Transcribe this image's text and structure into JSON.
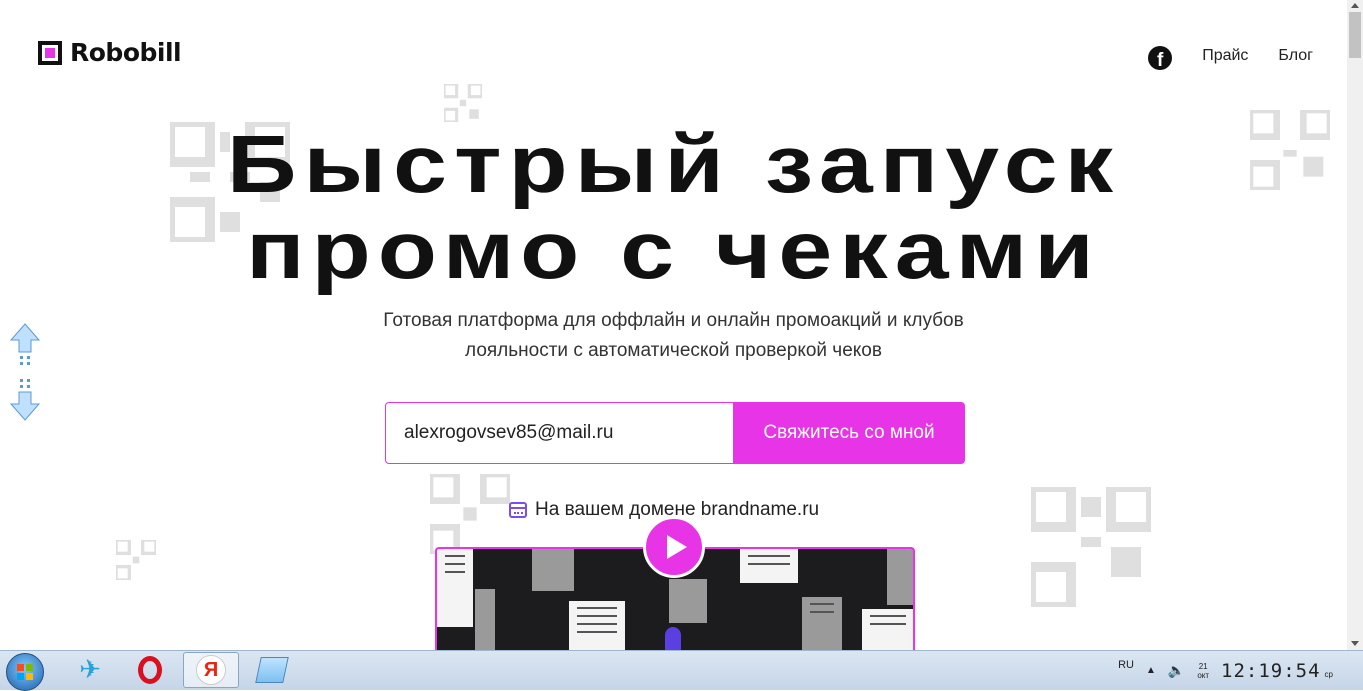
{
  "header": {
    "logo_text": "Robobill",
    "nav": [
      {
        "label": "Прайс"
      },
      {
        "label": "Блог"
      }
    ]
  },
  "hero": {
    "title_line1": "Быстрый запуск",
    "title_line2": "промо с чеками",
    "subtitle_line1": "Готовая платформа для оффлайн и онлайн промоакций и клубов",
    "subtitle_line2": "лояльности с автоматической проверкой чеков"
  },
  "form": {
    "email_value": "alexrogovsev85@mail.ru",
    "button_label": "Свяжитесь со мной"
  },
  "domain_note": "На вашем домене brandname.ru",
  "colors": {
    "accent": "#e634e6",
    "text": "#111111",
    "icon_accent": "#7a4df0"
  },
  "taskbar": {
    "apps": [
      "start-button",
      "bird-app",
      "opera-browser",
      "yandex-browser",
      "notepad-app"
    ],
    "tray": {
      "lang": "RU",
      "date_top": "21",
      "date_bottom": "окт",
      "time": "12:19:54",
      "day": "ср"
    }
  }
}
